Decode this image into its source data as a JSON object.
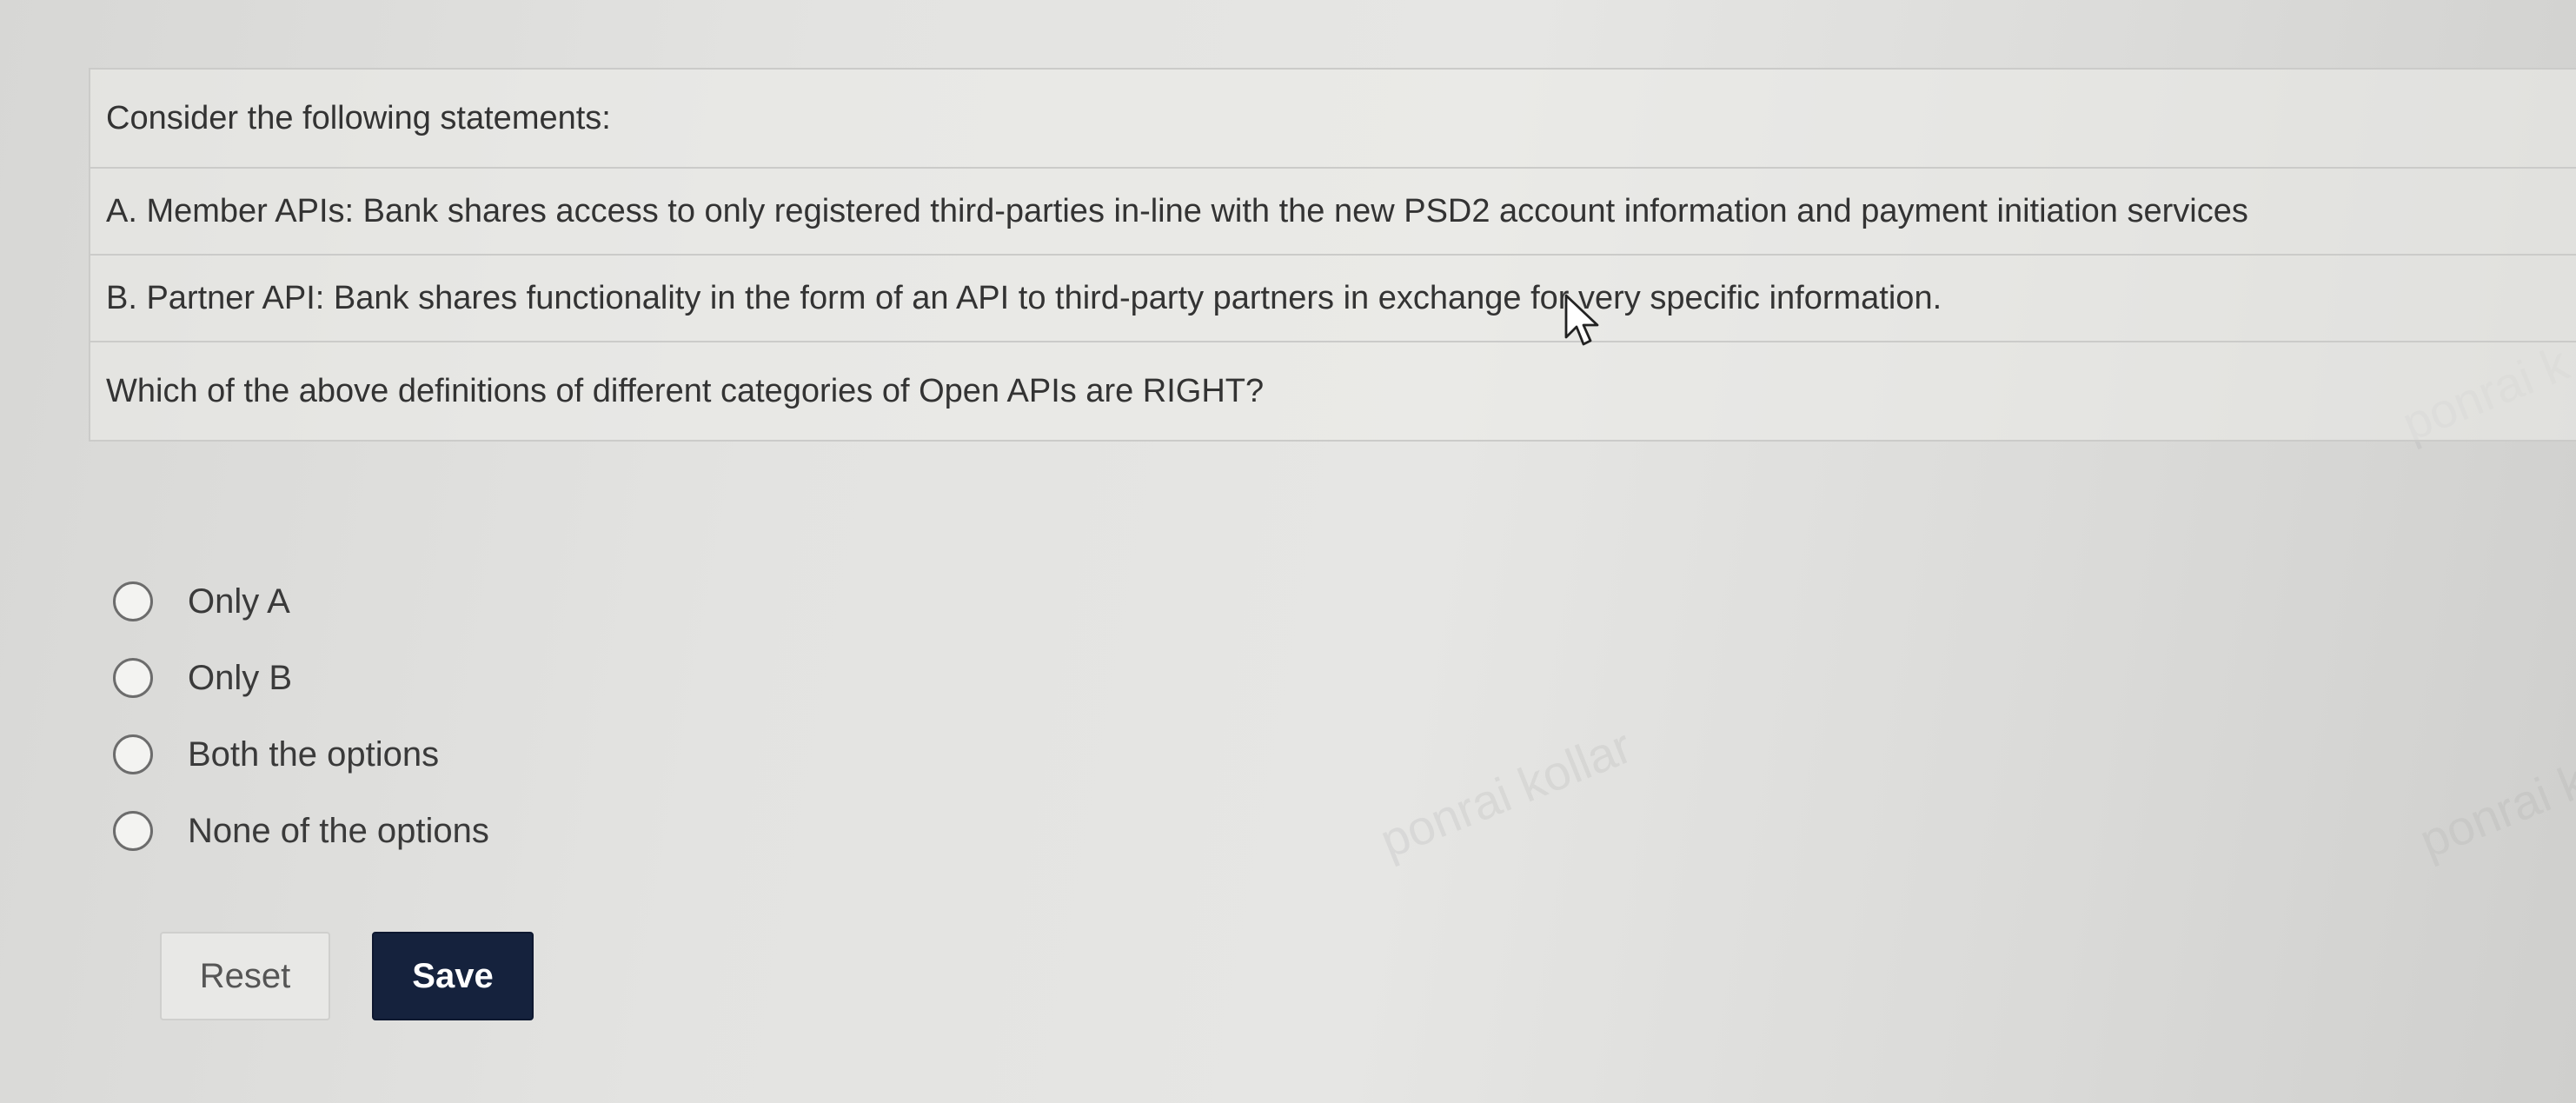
{
  "question": {
    "intro": "Consider the following statements:",
    "statement_a": "A. Member APIs: Bank shares access to only registered third-parties in-line with the new PSD2 account information and payment initiation services",
    "statement_b": "B. Partner API: Bank shares functionality in the form of an API to third-party partners in exchange for very specific information.",
    "prompt": "Which of the above definitions of different categories of Open APIs are RIGHT?"
  },
  "options": [
    {
      "label": "Only A",
      "selected": false
    },
    {
      "label": "Only B",
      "selected": false
    },
    {
      "label": "Both the options",
      "selected": false
    },
    {
      "label": "None of the options",
      "selected": false
    }
  ],
  "buttons": {
    "reset_label": "Reset",
    "save_label": "Save"
  },
  "colors": {
    "save_button_bg": "#15223d",
    "background": "#e3e3e1"
  }
}
